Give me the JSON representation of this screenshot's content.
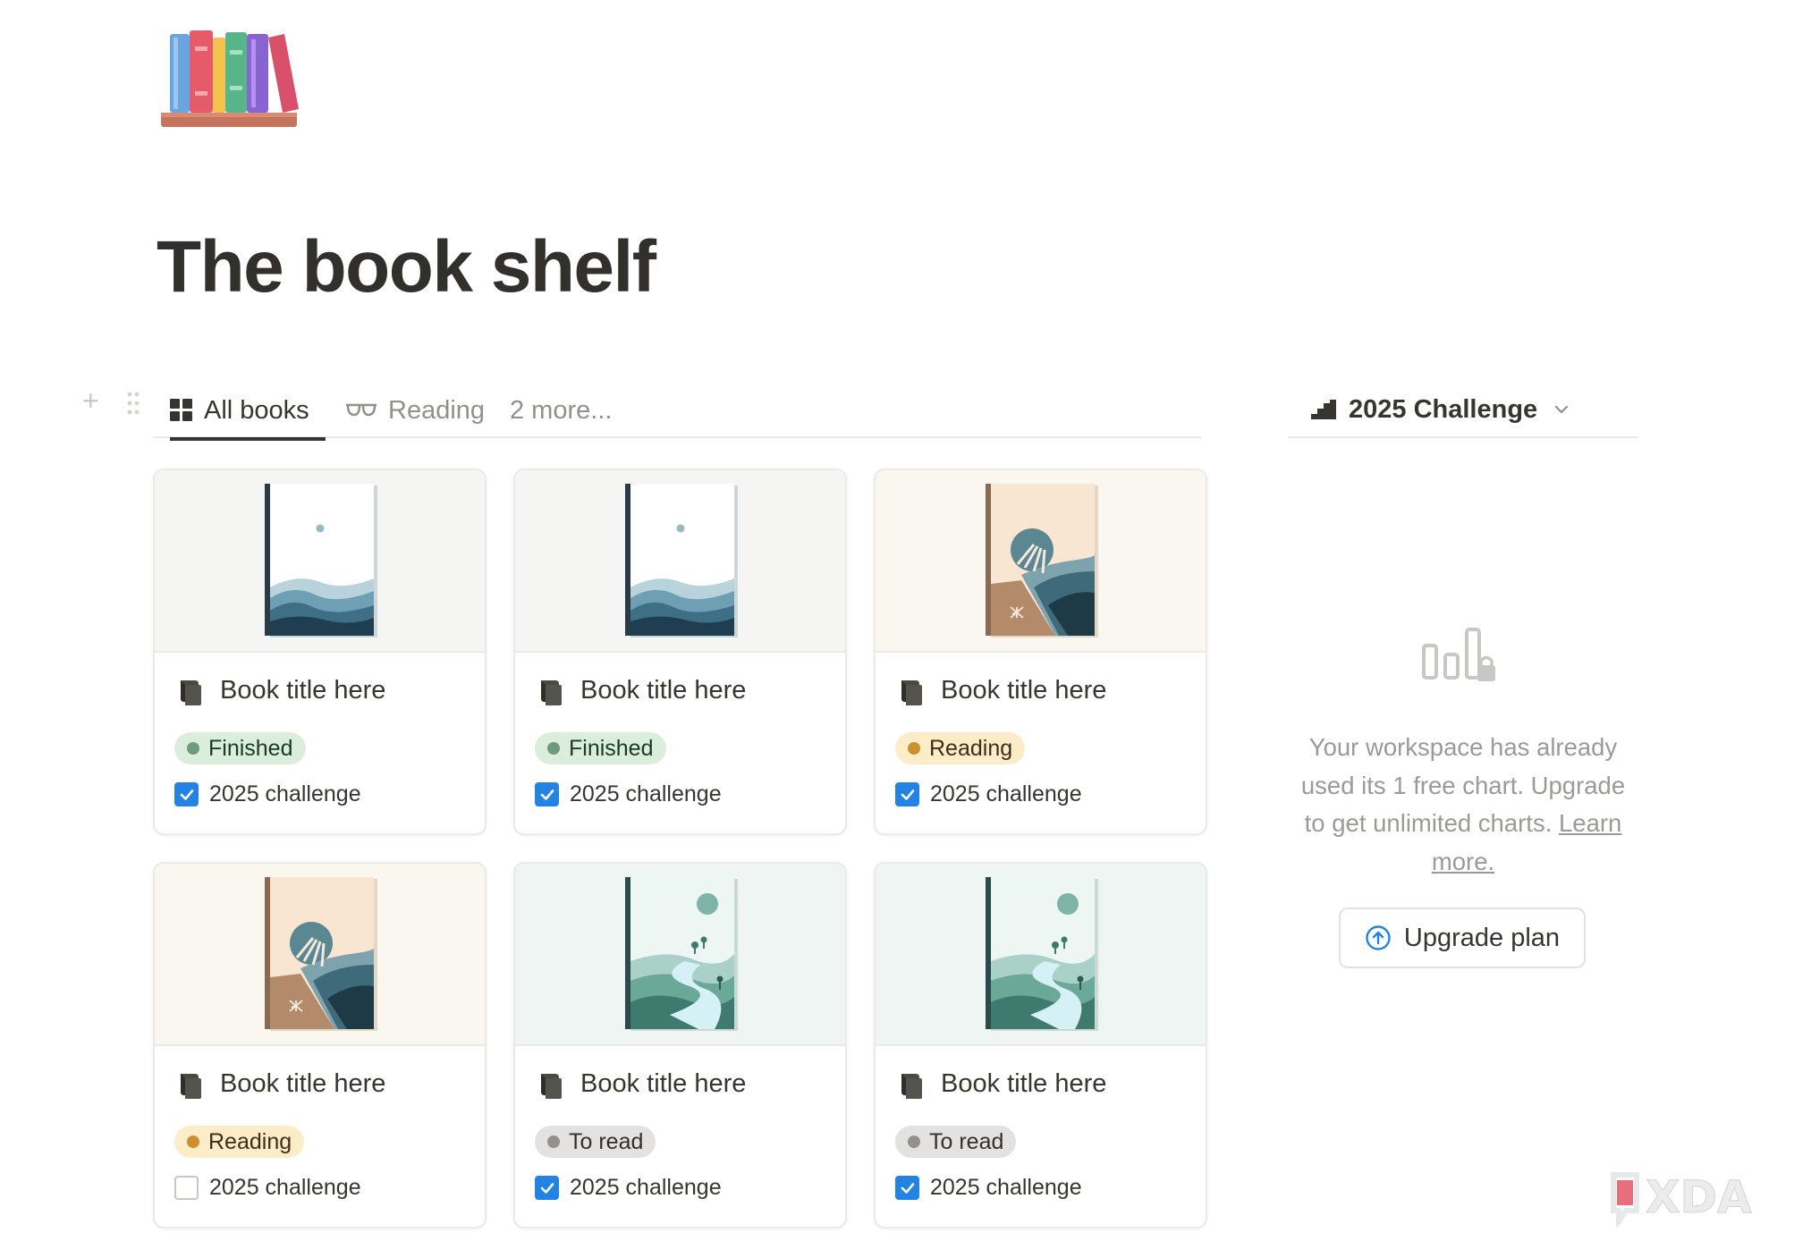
{
  "page": {
    "title": "The book shelf",
    "icon": "books-icon"
  },
  "tabs": {
    "items": [
      {
        "label": "All books",
        "icon": "grid-icon",
        "active": true
      },
      {
        "label": "Reading",
        "icon": "glasses-icon",
        "active": false
      }
    ],
    "more_label": "2 more..."
  },
  "chart_panel": {
    "tab_label": "2025 Challenge",
    "tab_icon": "stairs-icon",
    "message": "Your workspace has already used its 1 free chart. Upgrade to get unlimited charts.",
    "link_label": "Learn more.",
    "button_label": "Upgrade plan",
    "button_icon": "arrow-up-circle-icon"
  },
  "status_colors": {
    "Finished": {
      "bg": "#dbeddb",
      "dot": "#6c9b7d",
      "text": "#1c3829"
    },
    "Reading": {
      "bg": "#fdecc8",
      "dot": "#cb912f",
      "text": "#402c1b"
    },
    "To read": {
      "bg": "#e3e2e0",
      "dot": "#91918e",
      "text": "#32302c"
    }
  },
  "cards": [
    {
      "title": "Book title here",
      "status": "Finished",
      "challenge_label": "2025 challenge",
      "challenge_checked": true,
      "cover": "wave"
    },
    {
      "title": "Book title here",
      "status": "Finished",
      "challenge_label": "2025 challenge",
      "challenge_checked": true,
      "cover": "wave"
    },
    {
      "title": "Book title here",
      "status": "Reading",
      "challenge_label": "2025 challenge",
      "challenge_checked": true,
      "cover": "shell"
    },
    {
      "title": "Book title here",
      "status": "Reading",
      "challenge_label": "2025 challenge",
      "challenge_checked": false,
      "cover": "shell"
    },
    {
      "title": "Book title here",
      "status": "To read",
      "challenge_label": "2025 challenge",
      "challenge_checked": true,
      "cover": "river"
    },
    {
      "title": "Book title here",
      "status": "To read",
      "challenge_label": "2025 challenge",
      "challenge_checked": true,
      "cover": "river"
    }
  ],
  "watermark": "XDA"
}
